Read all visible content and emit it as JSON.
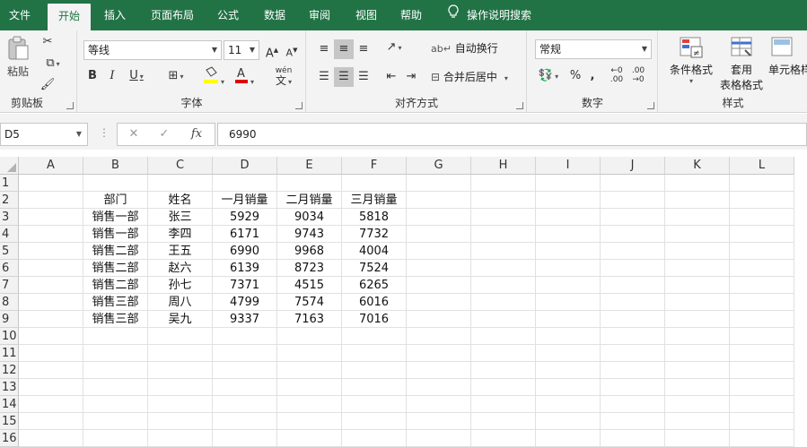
{
  "menu": {
    "tabs": [
      "文件",
      "开始",
      "插入",
      "页面布局",
      "公式",
      "数据",
      "审阅",
      "视图",
      "帮助"
    ],
    "active_tab": "开始",
    "tell_me": "操作说明搜索"
  },
  "ribbon": {
    "clipboard": {
      "paste": "粘贴",
      "label": "剪贴板"
    },
    "font": {
      "family": "等线",
      "size": "11",
      "bold": "B",
      "italic": "I",
      "underline": "U",
      "grow": "A",
      "shrink": "A",
      "phonetic": "wén",
      "label": "字体"
    },
    "alignment": {
      "wrap": "自动换行",
      "merge": "合并后居中",
      "label": "对齐方式"
    },
    "number": {
      "format": "常规",
      "percent": "%",
      "comma": ",",
      "inc_decimal": ".00",
      "label": "数字"
    },
    "styles": {
      "conditional": "条件格式",
      "table_line1": "套用",
      "table_line2": "表格格式",
      "cell": "单元格样",
      "label": "样式"
    }
  },
  "formula_bar": {
    "name_box": "D5",
    "cancel": "✕",
    "confirm": "✓",
    "fx": "fx",
    "value": "6990"
  },
  "sheet": {
    "columns": [
      "A",
      "B",
      "C",
      "D",
      "E",
      "F",
      "G",
      "H",
      "I",
      "J",
      "K",
      "L"
    ],
    "rows": [
      "1",
      "2",
      "3",
      "4",
      "5",
      "6",
      "7",
      "8",
      "9",
      "10",
      "11",
      "12",
      "13",
      "14",
      "15",
      "16"
    ],
    "table": {
      "headers": [
        "部门",
        "姓名",
        "一月销量",
        "二月销量",
        "三月销量"
      ],
      "rows": [
        [
          "销售一部",
          "张三",
          "5929",
          "9034",
          "5818"
        ],
        [
          "销售一部",
          "李四",
          "6171",
          "9743",
          "7732"
        ],
        [
          "销售二部",
          "王五",
          "6990",
          "9968",
          "4004"
        ],
        [
          "销售二部",
          "赵六",
          "6139",
          "8723",
          "7524"
        ],
        [
          "销售二部",
          "孙七",
          "7371",
          "4515",
          "6265"
        ],
        [
          "销售三部",
          "周八",
          "4799",
          "7574",
          "6016"
        ],
        [
          "销售三部",
          "吴九",
          "9337",
          "7163",
          "7016"
        ]
      ]
    }
  },
  "colors": {
    "brand": "#217346",
    "font_color": "#e00000",
    "highlight": "#ffff00"
  }
}
